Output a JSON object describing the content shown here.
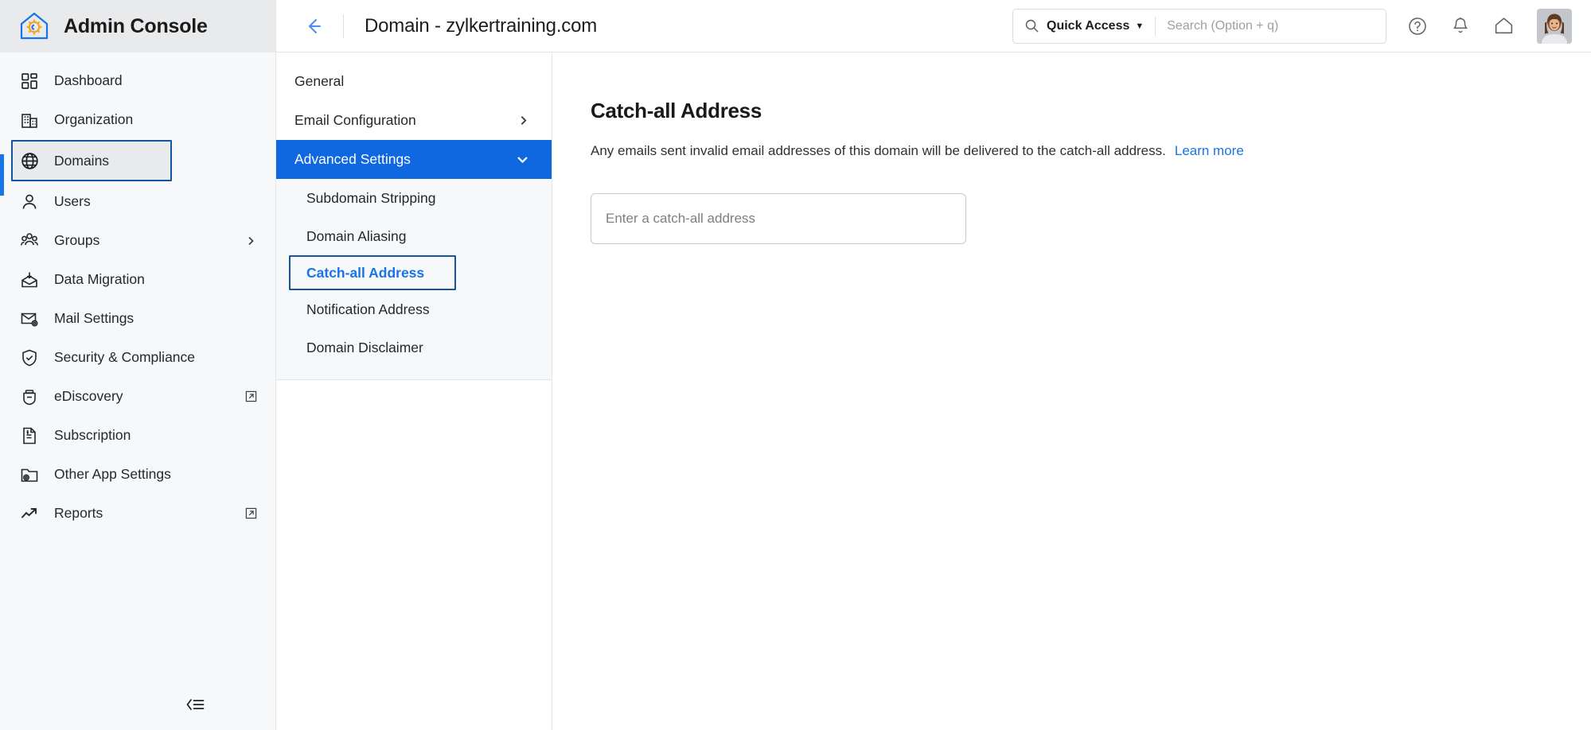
{
  "brand": {
    "title": "Admin Console",
    "logo_icon": "house-gear-icon",
    "logo_colors": {
      "outline": "#1a73e8",
      "gear": "#f5a623"
    }
  },
  "sidebar": {
    "items": [
      {
        "label": "Dashboard",
        "icon": "dashboard-grid-icon",
        "selected": false,
        "trailing": ""
      },
      {
        "label": "Organization",
        "icon": "building-icon",
        "selected": false,
        "trailing": ""
      },
      {
        "label": "Domains",
        "icon": "globe-icon",
        "selected": true,
        "trailing": ""
      },
      {
        "label": "Users",
        "icon": "user-icon",
        "selected": false,
        "trailing": ""
      },
      {
        "label": "Groups",
        "icon": "group-icon",
        "selected": false,
        "trailing": "chevron-right-icon"
      },
      {
        "label": "Data Migration",
        "icon": "envelope-download-icon",
        "selected": false,
        "trailing": ""
      },
      {
        "label": "Mail Settings",
        "icon": "envelope-gear-icon",
        "selected": false,
        "trailing": ""
      },
      {
        "label": "Security & Compliance",
        "icon": "shield-check-icon",
        "selected": false,
        "trailing": ""
      },
      {
        "label": "eDiscovery",
        "icon": "vault-icon",
        "selected": false,
        "trailing": "external-link-icon"
      },
      {
        "label": "Subscription",
        "icon": "invoice-icon",
        "selected": false,
        "trailing": ""
      },
      {
        "label": "Other App Settings",
        "icon": "folder-gear-icon",
        "selected": false,
        "trailing": ""
      },
      {
        "label": "Reports",
        "icon": "trend-arrow-icon",
        "selected": false,
        "trailing": "external-link-icon"
      }
    ],
    "collapse_icon": "collapse-sidebar-icon"
  },
  "topbar": {
    "back_icon": "arrow-left-icon",
    "title": "Domain - zylkertraining.com",
    "search": {
      "search_icon": "search-icon",
      "scope_label": "Quick Access",
      "scope_caret": "chevron-down-icon",
      "placeholder": "Search (Option + q)",
      "value": ""
    },
    "icons": [
      {
        "name": "help-icon",
        "glyph": "?"
      },
      {
        "name": "notifications-bell-icon",
        "glyph": "bell"
      },
      {
        "name": "home-icon",
        "glyph": "home"
      }
    ],
    "avatar_alt": "user-avatar"
  },
  "subnav": {
    "items": [
      {
        "label": "General",
        "type": "item",
        "trailing": "",
        "state": "normal"
      },
      {
        "label": "Email Configuration",
        "type": "item",
        "trailing": "chevron-right-icon",
        "state": "normal"
      },
      {
        "label": "Advanced Settings",
        "type": "item",
        "trailing": "chevron-down-icon",
        "state": "expanded-active"
      }
    ],
    "children": [
      {
        "label": "Subdomain Stripping",
        "selected": false
      },
      {
        "label": "Domain Aliasing",
        "selected": false
      },
      {
        "label": "Catch-all Address",
        "selected": true
      },
      {
        "label": "Notification Address",
        "selected": false
      },
      {
        "label": "Domain Disclaimer",
        "selected": false
      }
    ]
  },
  "main": {
    "heading": "Catch-all Address",
    "description": "Any emails sent invalid email addresses of this domain will be delivered to the catch-all address.",
    "learn_more": "Learn more",
    "input": {
      "placeholder": "Enter a catch-all address",
      "value": ""
    }
  },
  "colors": {
    "accent_blue": "#1a73e8",
    "active_blue_bg": "#0f68e0",
    "focus_ring": "#13569f",
    "sidebar_bg": "#f7f8fa",
    "brand_bg": "#e9eaec",
    "text": "#25282b"
  }
}
